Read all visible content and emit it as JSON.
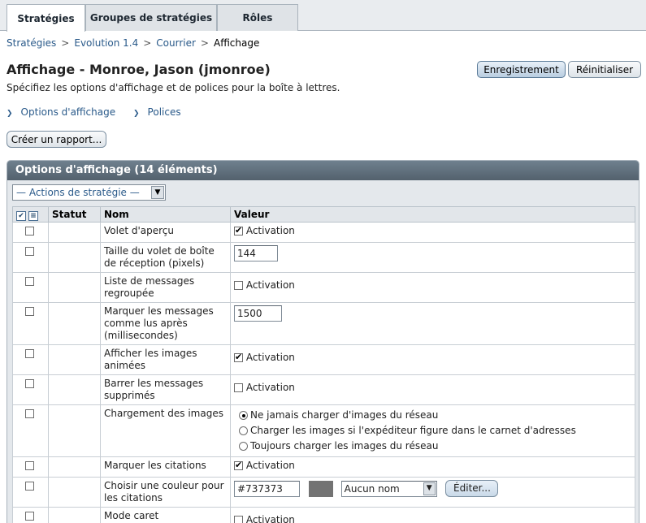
{
  "tabs": [
    {
      "label": "Stratégies"
    },
    {
      "label": "Groupes de stratégies"
    },
    {
      "label": "Rôles"
    }
  ],
  "breadcrumb": {
    "items": [
      "Stratégies",
      "Evolution 1.4",
      "Courrier"
    ],
    "current": "Affichage",
    "separator": ">"
  },
  "page": {
    "title": "Affichage - Monroe, Jason (jmonroe)",
    "description": "Spécifiez les options d'affichage et de polices pour la boîte à lettres.",
    "save_label": "Enregistrement",
    "reset_label": "Réinitialiser",
    "jump_links": [
      "Options d'affichage",
      "Polices"
    ],
    "report_label": "Créer un rapport..."
  },
  "panel": {
    "title": "Options d'affichage (14 éléments)",
    "actions_select": "— Actions de stratégie —",
    "columns": {
      "status": "Statut",
      "name": "Nom",
      "value": "Valeur"
    }
  },
  "rows": {
    "r0": {
      "name": "Volet d'aperçu",
      "value_label": "Activation",
      "checked": true
    },
    "r1": {
      "name": "Taille du volet de boîte de réception (pixels)",
      "value": "144"
    },
    "r2": {
      "name": "Liste de messages regroupée",
      "value_label": "Activation",
      "checked": false
    },
    "r3": {
      "name": "Marquer les messages comme lus après (millisecondes)",
      "value": "1500"
    },
    "r4": {
      "name": "Afficher les images animées",
      "value_label": "Activation",
      "checked": true
    },
    "r5": {
      "name": "Barrer les messages supprimés",
      "value_label": "Activation",
      "checked": false
    },
    "r6": {
      "name": "Chargement des images",
      "options": [
        "Ne jamais charger d'images du réseau",
        "Charger les images si l'expéditeur figure dans le carnet d'adresses",
        "Toujours charger les images du réseau"
      ],
      "selected_index": 0
    },
    "r7": {
      "name": "Marquer les citations",
      "value_label": "Activation",
      "checked": true
    },
    "r8": {
      "name": "Choisir une couleur pour les citations",
      "value": "#737373",
      "swatch": "#737373",
      "select": "Aucun nom",
      "edit_label": "Éditer..."
    },
    "r9": {
      "name": "Mode caret",
      "value_label": "Activation",
      "checked": false
    }
  },
  "colors": {
    "link": "#2a5a8a",
    "panel_header": "#5f6e7b",
    "primary_button": "#c4d6e8"
  }
}
